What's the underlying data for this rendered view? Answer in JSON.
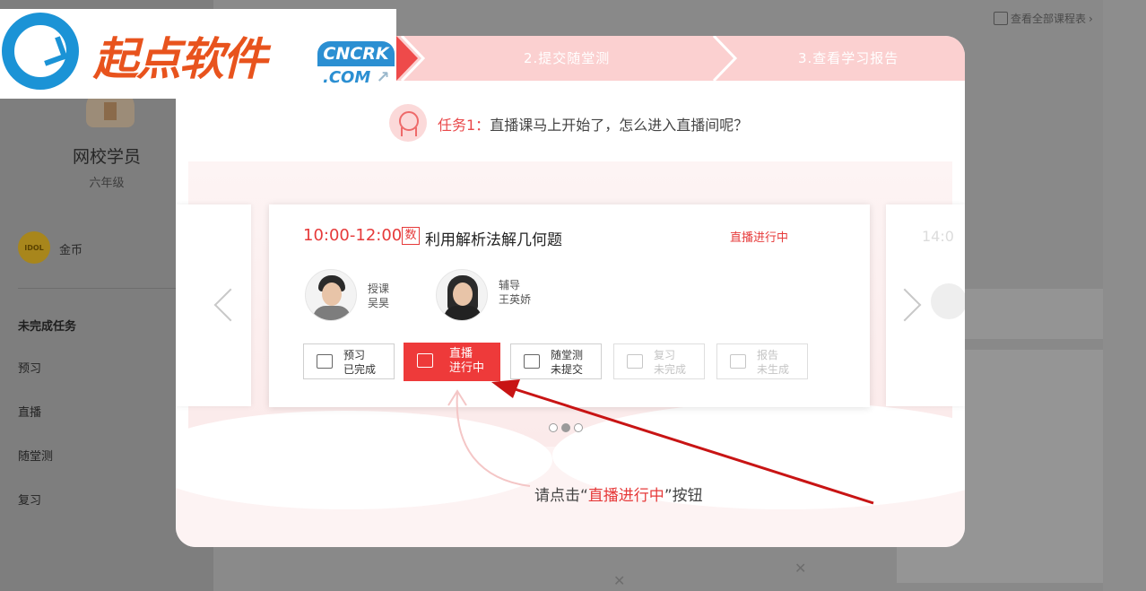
{
  "sidebar": {
    "user_name": "网校学员",
    "grade": "六年级",
    "coin_badge": "IDOL",
    "coin_label": "金币",
    "menu_title": "未完成任务",
    "menu_items": [
      "预习",
      "直播",
      "随堂测",
      "复习"
    ]
  },
  "header": {
    "schedule_link": "查看全部课程表"
  },
  "watermark": {
    "brand_cn": "起点软件",
    "brand_en_top": "CNCRK",
    "brand_en_bottom": ".COM"
  },
  "modal": {
    "steps": [
      "2.提交随堂测",
      "3.查看学习报告"
    ],
    "task_label": "任务1：",
    "task_question": "直播课马上开始了，怎么进入直播间呢？",
    "card": {
      "time": "10:00-12:00",
      "subject_badge": "数",
      "title": "利用解析法解几何题",
      "status": "直播进行中",
      "teacher_role": "授课",
      "teacher_name": "吴昊",
      "tutor_role": "辅导",
      "tutor_name": "王英娇",
      "actions": [
        {
          "line1": "预习",
          "line2": "已完成"
        },
        {
          "line1": "直播",
          "line2": "进行中"
        },
        {
          "line1": "随堂测",
          "line2": "未提交"
        },
        {
          "line1": "复习",
          "line2": "未完成"
        },
        {
          "line1": "报告",
          "line2": "未生成"
        }
      ]
    },
    "next_card_time": "14:0",
    "pager": {
      "count": 3,
      "active_index": 1
    },
    "hint_prefix": "请点击“",
    "hint_highlight": "直播进行中",
    "hint_suffix": "”按钮"
  },
  "colors": {
    "accent_red": "#ee3a3a",
    "step_bar_pink": "#fbd0d0",
    "brand_blue": "#1b93d6",
    "brand_orange": "#e8531d"
  }
}
